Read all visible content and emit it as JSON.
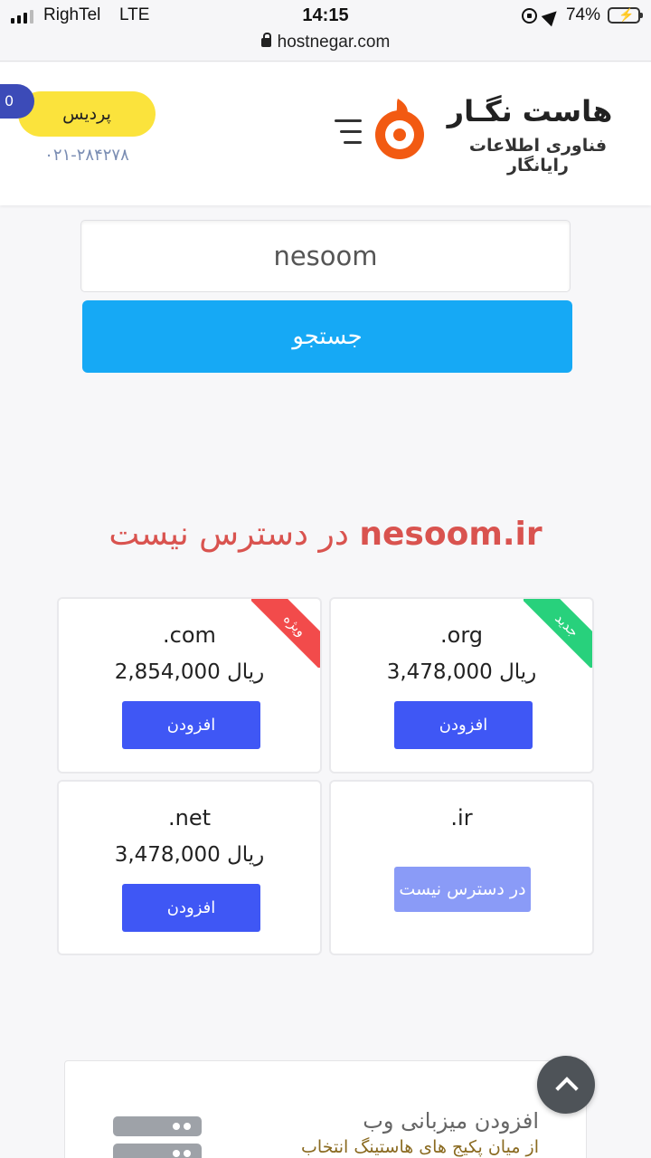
{
  "status_bar": {
    "carrier": "RighTel",
    "network": "LTE",
    "time": "14:15",
    "url": "hostnegar.com",
    "battery": "74%",
    "battery_level": 0.74
  },
  "header": {
    "cart_count": "0",
    "user_button": "پردیس",
    "phone": "۰۲۱-۲۸۴۲۷۸",
    "logo_title": "هاست نگـار",
    "logo_subtitle": "فناوری اطلاعات رایانگار",
    "brand_color": "#f25a12"
  },
  "search": {
    "value": "nesoom",
    "button_label": "جستجو"
  },
  "result": {
    "domain": "nesoom.ir",
    "message": "در دسترس نیست"
  },
  "domains": [
    {
      "tld": ".org",
      "price": "3,478,000",
      "currency": "ریال",
      "button": "افزودن",
      "ribbon": "جدید",
      "ribbon_color": "#28d17c",
      "available": true
    },
    {
      "tld": ".com",
      "price": "2,854,000",
      "currency": "ریال",
      "button": "افزودن",
      "ribbon": "ویژه",
      "ribbon_color": "#f24b4b",
      "available": true
    },
    {
      "tld": ".ir",
      "button": "در دسترس نیست",
      "available": false
    },
    {
      "tld": ".net",
      "price": "3,478,000",
      "currency": "ریال",
      "button": "افزودن",
      "available": true
    }
  ],
  "hosting": {
    "title": "افزودن میزبانی وب",
    "description": "از میان پکیج های هاستینگ انتخاب"
  },
  "scroll_top_icon": "chevron-up-icon"
}
